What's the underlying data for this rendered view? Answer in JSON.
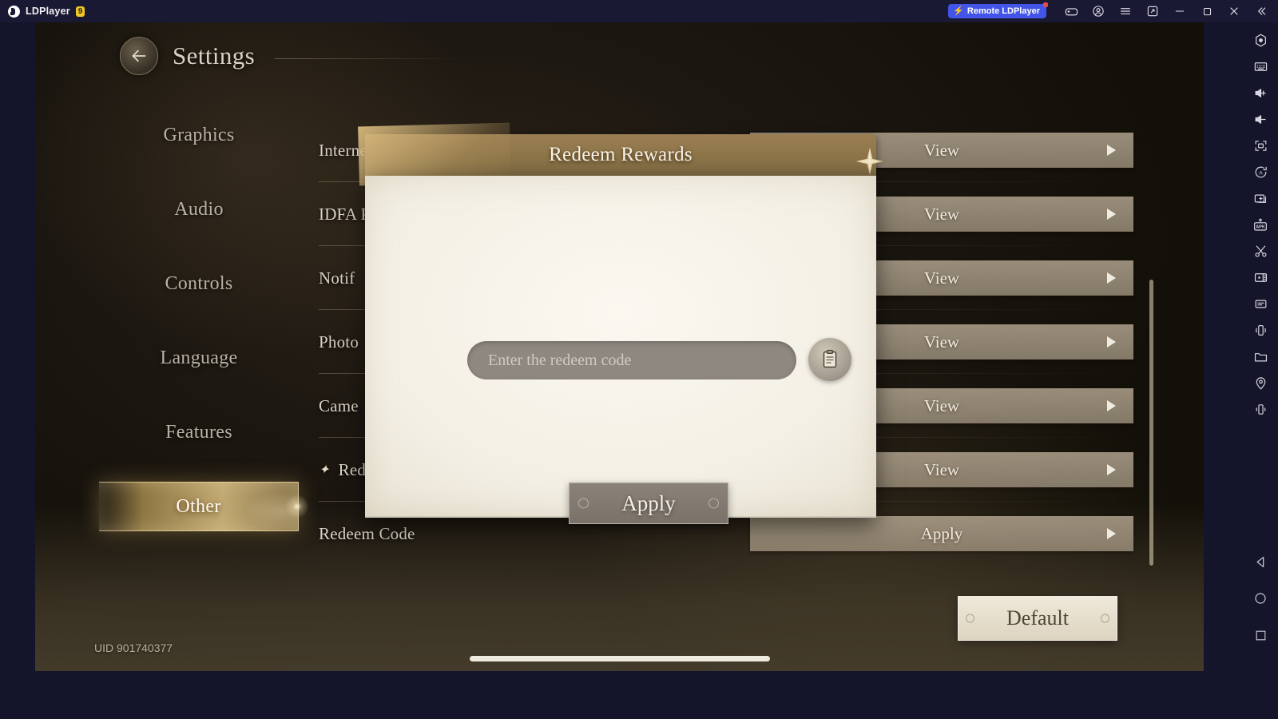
{
  "window": {
    "app_name": "LDPlayer",
    "version_badge": "9",
    "remote_button": "Remote LDPlayer",
    "titlebar_icons": [
      {
        "name": "gamepad-icon"
      },
      {
        "name": "account-icon"
      },
      {
        "name": "menu-icon"
      },
      {
        "name": "multi-instance-icon"
      },
      {
        "name": "minimize-icon"
      },
      {
        "name": "maximize-icon"
      },
      {
        "name": "close-icon"
      },
      {
        "name": "collapse-icon"
      }
    ]
  },
  "rail": {
    "icons": [
      {
        "name": "settings-hexagon-icon"
      },
      {
        "name": "keyboard-icon"
      },
      {
        "name": "volume-up-icon"
      },
      {
        "name": "volume-down-icon"
      },
      {
        "name": "fullscreen-icon"
      },
      {
        "name": "auto-rotate-icon"
      },
      {
        "name": "multi-window-icon"
      },
      {
        "name": "apk-install-icon"
      },
      {
        "name": "scissors-screenshot-icon"
      },
      {
        "name": "video-record-icon"
      },
      {
        "name": "script-icon"
      },
      {
        "name": "shake-icon"
      },
      {
        "name": "folder-icon"
      },
      {
        "name": "location-icon"
      },
      {
        "name": "vibrate-icon"
      }
    ],
    "nav": [
      {
        "name": "android-back-button"
      },
      {
        "name": "android-home-button"
      },
      {
        "name": "android-recents-button"
      }
    ]
  },
  "settings": {
    "title": "Settings",
    "back_icon": "back-arrow-icon",
    "nav_items": [
      {
        "label": "Graphics",
        "active": false
      },
      {
        "label": "Audio",
        "active": false
      },
      {
        "label": "Controls",
        "active": false
      },
      {
        "label": "Language",
        "active": false
      },
      {
        "label": "Features",
        "active": false
      },
      {
        "label": "Other",
        "active": true
      }
    ],
    "rows": [
      {
        "label": "Internet Permissions",
        "help": "?",
        "action": "View",
        "sparkle": false
      },
      {
        "label": "IDFA P",
        "help": "",
        "action": "View",
        "sparkle": false
      },
      {
        "label": "Notif",
        "help": "",
        "action": "View",
        "sparkle": false
      },
      {
        "label": "Photo",
        "help": "",
        "action": "View",
        "sparkle": false
      },
      {
        "label": "Came",
        "help": "",
        "action": "View",
        "sparkle": false
      },
      {
        "label": "Redeem C",
        "help": "",
        "action": "View",
        "sparkle": true
      },
      {
        "label": "Redeem Code",
        "help": "",
        "action": "Apply",
        "sparkle": false
      }
    ],
    "default_button": "Default",
    "uid": "UID 901740377"
  },
  "modal": {
    "title": "Redeem Rewards",
    "close_icon": "star-close-icon",
    "input_placeholder": "Enter the redeem code",
    "input_value": "",
    "paste_icon": "paste-clipboard-icon",
    "apply_button": "Apply"
  },
  "colors": {
    "chrome": "#191933",
    "rail": "#14142a",
    "remote_accent": "#4255e8",
    "version_badge": "#f2c81e",
    "gold_active": "#e6c88c",
    "modal_header": "#8d7549",
    "modal_body": "#f6f2e8"
  }
}
